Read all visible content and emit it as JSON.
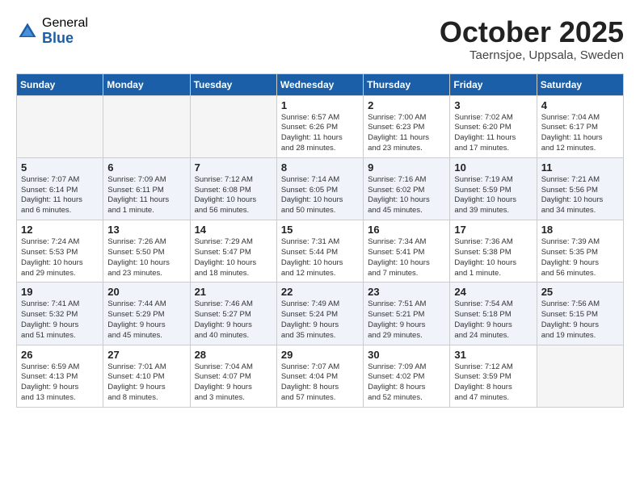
{
  "header": {
    "logo_general": "General",
    "logo_blue": "Blue",
    "month_title": "October 2025",
    "subtitle": "Taernsjoe, Uppsala, Sweden"
  },
  "days_of_week": [
    "Sunday",
    "Monday",
    "Tuesday",
    "Wednesday",
    "Thursday",
    "Friday",
    "Saturday"
  ],
  "weeks": [
    {
      "row_class": "row-white",
      "days": [
        {
          "num": "",
          "text": "",
          "empty": true
        },
        {
          "num": "",
          "text": "",
          "empty": true
        },
        {
          "num": "",
          "text": "",
          "empty": true
        },
        {
          "num": "1",
          "text": "Sunrise: 6:57 AM\nSunset: 6:26 PM\nDaylight: 11 hours\nand 28 minutes.",
          "empty": false
        },
        {
          "num": "2",
          "text": "Sunrise: 7:00 AM\nSunset: 6:23 PM\nDaylight: 11 hours\nand 23 minutes.",
          "empty": false
        },
        {
          "num": "3",
          "text": "Sunrise: 7:02 AM\nSunset: 6:20 PM\nDaylight: 11 hours\nand 17 minutes.",
          "empty": false
        },
        {
          "num": "4",
          "text": "Sunrise: 7:04 AM\nSunset: 6:17 PM\nDaylight: 11 hours\nand 12 minutes.",
          "empty": false
        }
      ]
    },
    {
      "row_class": "row-light",
      "days": [
        {
          "num": "5",
          "text": "Sunrise: 7:07 AM\nSunset: 6:14 PM\nDaylight: 11 hours\nand 6 minutes.",
          "empty": false
        },
        {
          "num": "6",
          "text": "Sunrise: 7:09 AM\nSunset: 6:11 PM\nDaylight: 11 hours\nand 1 minute.",
          "empty": false
        },
        {
          "num": "7",
          "text": "Sunrise: 7:12 AM\nSunset: 6:08 PM\nDaylight: 10 hours\nand 56 minutes.",
          "empty": false
        },
        {
          "num": "8",
          "text": "Sunrise: 7:14 AM\nSunset: 6:05 PM\nDaylight: 10 hours\nand 50 minutes.",
          "empty": false
        },
        {
          "num": "9",
          "text": "Sunrise: 7:16 AM\nSunset: 6:02 PM\nDaylight: 10 hours\nand 45 minutes.",
          "empty": false
        },
        {
          "num": "10",
          "text": "Sunrise: 7:19 AM\nSunset: 5:59 PM\nDaylight: 10 hours\nand 39 minutes.",
          "empty": false
        },
        {
          "num": "11",
          "text": "Sunrise: 7:21 AM\nSunset: 5:56 PM\nDaylight: 10 hours\nand 34 minutes.",
          "empty": false
        }
      ]
    },
    {
      "row_class": "row-white",
      "days": [
        {
          "num": "12",
          "text": "Sunrise: 7:24 AM\nSunset: 5:53 PM\nDaylight: 10 hours\nand 29 minutes.",
          "empty": false
        },
        {
          "num": "13",
          "text": "Sunrise: 7:26 AM\nSunset: 5:50 PM\nDaylight: 10 hours\nand 23 minutes.",
          "empty": false
        },
        {
          "num": "14",
          "text": "Sunrise: 7:29 AM\nSunset: 5:47 PM\nDaylight: 10 hours\nand 18 minutes.",
          "empty": false
        },
        {
          "num": "15",
          "text": "Sunrise: 7:31 AM\nSunset: 5:44 PM\nDaylight: 10 hours\nand 12 minutes.",
          "empty": false
        },
        {
          "num": "16",
          "text": "Sunrise: 7:34 AM\nSunset: 5:41 PM\nDaylight: 10 hours\nand 7 minutes.",
          "empty": false
        },
        {
          "num": "17",
          "text": "Sunrise: 7:36 AM\nSunset: 5:38 PM\nDaylight: 10 hours\nand 1 minute.",
          "empty": false
        },
        {
          "num": "18",
          "text": "Sunrise: 7:39 AM\nSunset: 5:35 PM\nDaylight: 9 hours\nand 56 minutes.",
          "empty": false
        }
      ]
    },
    {
      "row_class": "row-light",
      "days": [
        {
          "num": "19",
          "text": "Sunrise: 7:41 AM\nSunset: 5:32 PM\nDaylight: 9 hours\nand 51 minutes.",
          "empty": false
        },
        {
          "num": "20",
          "text": "Sunrise: 7:44 AM\nSunset: 5:29 PM\nDaylight: 9 hours\nand 45 minutes.",
          "empty": false
        },
        {
          "num": "21",
          "text": "Sunrise: 7:46 AM\nSunset: 5:27 PM\nDaylight: 9 hours\nand 40 minutes.",
          "empty": false
        },
        {
          "num": "22",
          "text": "Sunrise: 7:49 AM\nSunset: 5:24 PM\nDaylight: 9 hours\nand 35 minutes.",
          "empty": false
        },
        {
          "num": "23",
          "text": "Sunrise: 7:51 AM\nSunset: 5:21 PM\nDaylight: 9 hours\nand 29 minutes.",
          "empty": false
        },
        {
          "num": "24",
          "text": "Sunrise: 7:54 AM\nSunset: 5:18 PM\nDaylight: 9 hours\nand 24 minutes.",
          "empty": false
        },
        {
          "num": "25",
          "text": "Sunrise: 7:56 AM\nSunset: 5:15 PM\nDaylight: 9 hours\nand 19 minutes.",
          "empty": false
        }
      ]
    },
    {
      "row_class": "row-white",
      "days": [
        {
          "num": "26",
          "text": "Sunrise: 6:59 AM\nSunset: 4:13 PM\nDaylight: 9 hours\nand 13 minutes.",
          "empty": false
        },
        {
          "num": "27",
          "text": "Sunrise: 7:01 AM\nSunset: 4:10 PM\nDaylight: 9 hours\nand 8 minutes.",
          "empty": false
        },
        {
          "num": "28",
          "text": "Sunrise: 7:04 AM\nSunset: 4:07 PM\nDaylight: 9 hours\nand 3 minutes.",
          "empty": false
        },
        {
          "num": "29",
          "text": "Sunrise: 7:07 AM\nSunset: 4:04 PM\nDaylight: 8 hours\nand 57 minutes.",
          "empty": false
        },
        {
          "num": "30",
          "text": "Sunrise: 7:09 AM\nSunset: 4:02 PM\nDaylight: 8 hours\nand 52 minutes.",
          "empty": false
        },
        {
          "num": "31",
          "text": "Sunrise: 7:12 AM\nSunset: 3:59 PM\nDaylight: 8 hours\nand 47 minutes.",
          "empty": false
        },
        {
          "num": "",
          "text": "",
          "empty": true
        }
      ]
    }
  ]
}
